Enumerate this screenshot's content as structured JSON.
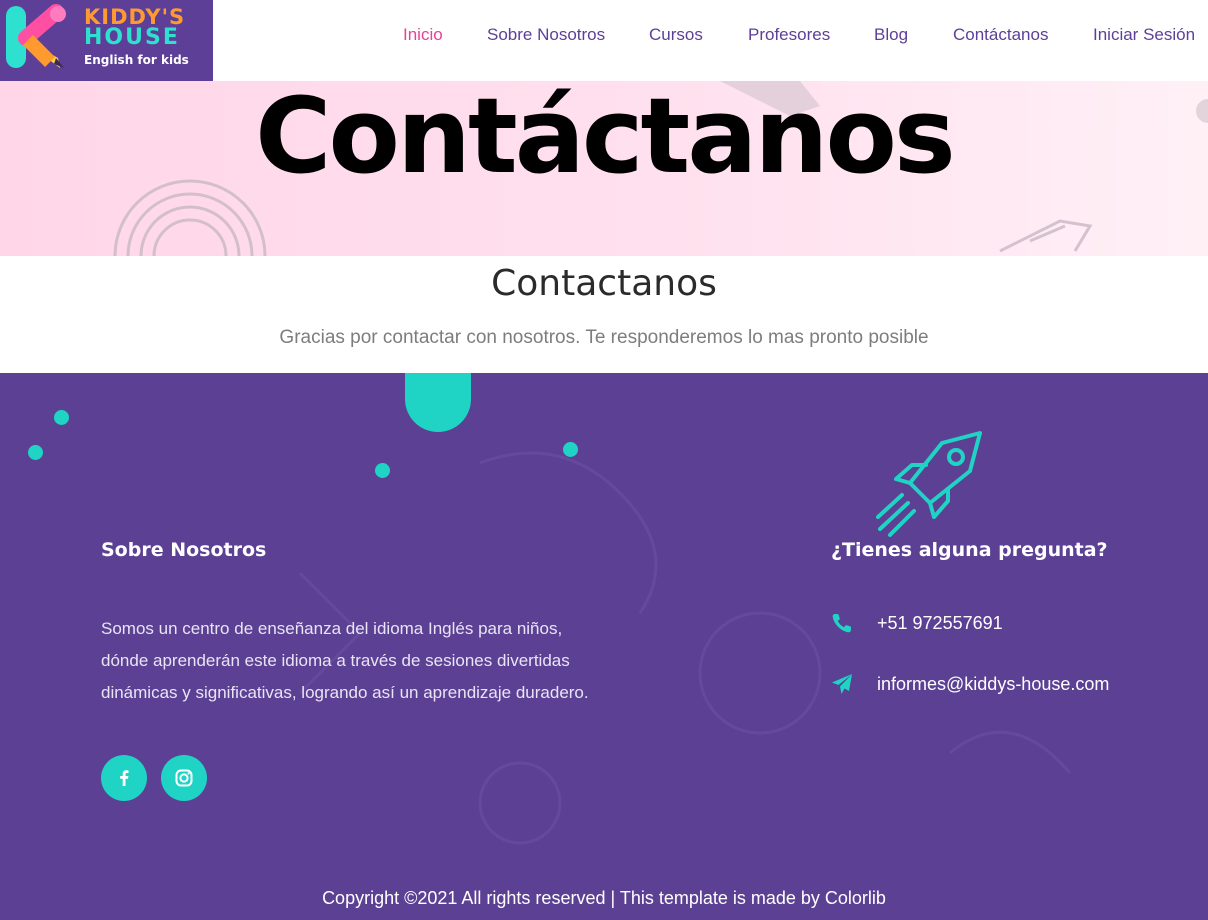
{
  "brand": {
    "name_line1": "KIDDY'S",
    "name_line2": "HOUSE",
    "tagline": "English for kids",
    "colors": {
      "purple": "#5e3f97",
      "pink": "#e8419a",
      "teal": "#1fd4c4",
      "orange": "#ff9a2e"
    }
  },
  "nav": {
    "items": [
      {
        "label": "Inicio",
        "active": true
      },
      {
        "label": "Sobre Nosotros",
        "active": false
      },
      {
        "label": "Cursos",
        "active": false
      },
      {
        "label": "Profesores",
        "active": false
      },
      {
        "label": "Blog",
        "active": false
      },
      {
        "label": "Contáctanos",
        "active": false
      },
      {
        "label": "Iniciar Sesión",
        "active": false
      }
    ]
  },
  "hero": {
    "title": "Contáctanos"
  },
  "message": {
    "title": "Contactanos",
    "text": "Gracias por contactar con nosotros. Te responderemos lo mas pronto posible"
  },
  "footer": {
    "about": {
      "heading": "Sobre Nosotros",
      "text": "Somos un centro de enseñanza del idioma Inglés para niños, dónde aprenderán este idioma a través de sesiones divertidas dinámicas y significativas, logrando así un aprendizaje duradero."
    },
    "social": [
      {
        "icon": "facebook-icon"
      },
      {
        "icon": "instagram-icon"
      }
    ],
    "contact": {
      "heading": "¿Tienes alguna pregunta?",
      "phone": "+51 972557691",
      "email": "informes@kiddys-house.com"
    },
    "copyright": "Copyright ©2021 All rights reserved | This template is made by Colorlib"
  }
}
